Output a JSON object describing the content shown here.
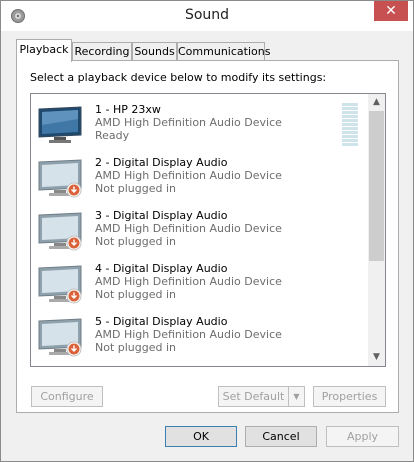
{
  "window": {
    "title": "Sound",
    "close_glyph": "✕"
  },
  "tabs": [
    {
      "label": "Playback",
      "active": true
    },
    {
      "label": "Recording",
      "active": false
    },
    {
      "label": "Sounds",
      "active": false
    },
    {
      "label": "Communications",
      "active": false
    }
  ],
  "playback": {
    "instruction": "Select a playback device below to modify its settings:",
    "devices": [
      {
        "name": "1 - HP 23xw",
        "driver": "AMD High Definition Audio Device",
        "status": "Ready",
        "icon": "monitor-icon",
        "default": true
      },
      {
        "name": "2 - Digital Display Audio",
        "driver": "AMD High Definition Audio Device",
        "status": "Not plugged in",
        "icon": "monitor-unplugged-icon"
      },
      {
        "name": "3 - Digital Display Audio",
        "driver": "AMD High Definition Audio Device",
        "status": "Not plugged in",
        "icon": "monitor-unplugged-icon"
      },
      {
        "name": "4 - Digital Display Audio",
        "driver": "AMD High Definition Audio Device",
        "status": "Not plugged in",
        "icon": "monitor-unplugged-icon"
      },
      {
        "name": "5 - Digital Display Audio",
        "driver": "AMD High Definition Audio Device",
        "status": "Not plugged in",
        "icon": "monitor-unplugged-icon"
      }
    ],
    "buttons": {
      "configure": "Configure",
      "set_default": "Set Default",
      "properties": "Properties"
    }
  },
  "footer": {
    "ok": "OK",
    "cancel": "Cancel",
    "apply": "Apply"
  },
  "colors": {
    "close": "#c75050",
    "focus_border": "#3c7fb1",
    "disabled_text": "#a0a0a0"
  }
}
